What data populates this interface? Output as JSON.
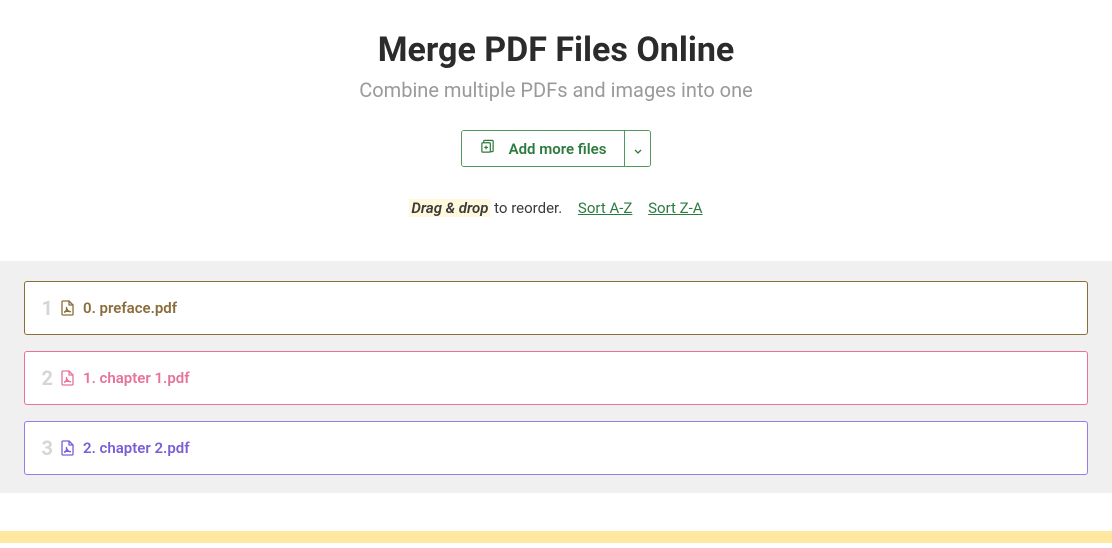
{
  "header": {
    "title": "Merge PDF Files Online",
    "subtitle": "Combine multiple PDFs and images into one"
  },
  "addFiles": {
    "label": "Add more files"
  },
  "reorder": {
    "dragLabel": "Drag & drop",
    "reorderText": " to reorder.",
    "sortAZ": "Sort A-Z",
    "sortZA": "Sort Z-A"
  },
  "files": [
    {
      "index": "1",
      "name": "0. preface.pdf",
      "colorClass": "file-brown",
      "iconStroke": "#8a6d3b"
    },
    {
      "index": "2",
      "name": "1. chapter 1.pdf",
      "colorClass": "file-pink",
      "iconStroke": "#e67399"
    },
    {
      "index": "3",
      "name": "2. chapter 2.pdf",
      "colorClass": "file-purple",
      "iconStroke": "#7a5ed6"
    }
  ]
}
